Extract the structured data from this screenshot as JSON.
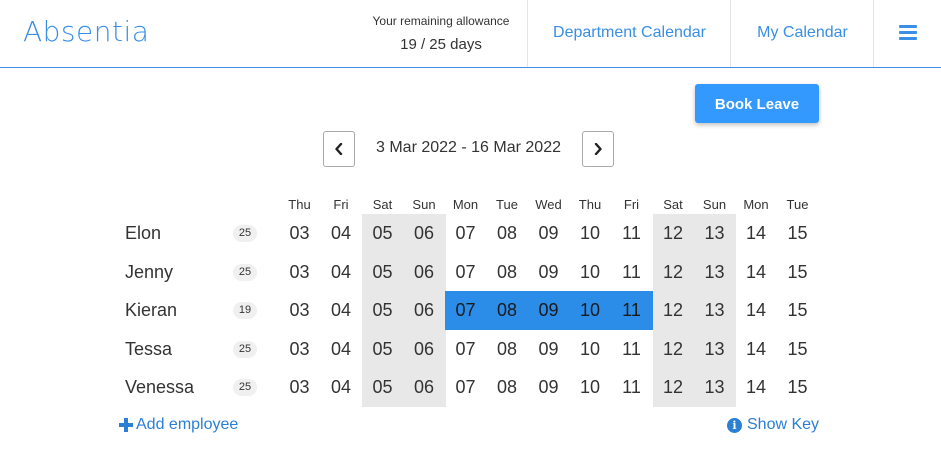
{
  "header": {
    "brand": "Absentia",
    "allowance_label": "Your remaining allowance",
    "allowance_value": "19 / 25 days",
    "nav_department": "Department Calendar",
    "nav_my": "My Calendar",
    "menu_icon": "hamburger-menu-icon"
  },
  "toolbar": {
    "book_leave": "Book Leave",
    "range": "3 Mar 2022 - 16 Mar 2022",
    "prev_icon": "chevron-left-icon",
    "next_icon": "chevron-right-icon"
  },
  "calendar": {
    "days": [
      {
        "name": "Thu",
        "date": "03",
        "weekend": false
      },
      {
        "name": "Fri",
        "date": "04",
        "weekend": false
      },
      {
        "name": "Sat",
        "date": "05",
        "weekend": true
      },
      {
        "name": "Sun",
        "date": "06",
        "weekend": true
      },
      {
        "name": "Mon",
        "date": "07",
        "weekend": false
      },
      {
        "name": "Tue",
        "date": "08",
        "weekend": false
      },
      {
        "name": "Wed",
        "date": "09",
        "weekend": false
      },
      {
        "name": "Thu",
        "date": "10",
        "weekend": false
      },
      {
        "name": "Fri",
        "date": "11",
        "weekend": false
      },
      {
        "name": "Sat",
        "date": "12",
        "weekend": true
      },
      {
        "name": "Sun",
        "date": "13",
        "weekend": true
      },
      {
        "name": "Mon",
        "date": "14",
        "weekend": false
      },
      {
        "name": "Tue",
        "date": "15",
        "weekend": false
      }
    ],
    "employees": [
      {
        "name": "Elon",
        "allowance": "25",
        "leave_days": []
      },
      {
        "name": "Jenny",
        "allowance": "25",
        "leave_days": []
      },
      {
        "name": "Kieran",
        "allowance": "19",
        "leave_days": [
          4,
          5,
          6,
          7,
          8
        ]
      },
      {
        "name": "Tessa",
        "allowance": "25",
        "leave_days": []
      },
      {
        "name": "Venessa",
        "allowance": "25",
        "leave_days": []
      }
    ],
    "colors": {
      "weekend": "#e8e8e8",
      "leave": "#2b8de8",
      "accent": "#3a8ee6"
    }
  },
  "footer": {
    "add_employee": "Add employee",
    "show_key": "Show Key",
    "add_icon": "plus-icon",
    "key_icon": "info-icon"
  }
}
